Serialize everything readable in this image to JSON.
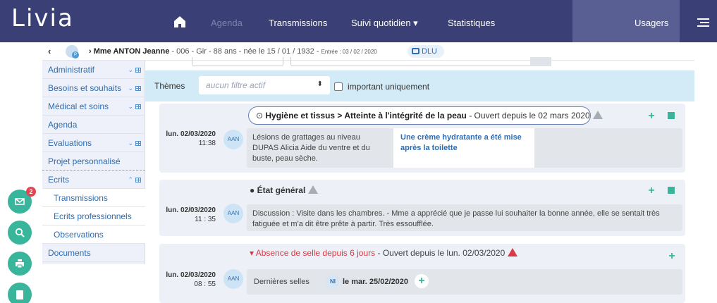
{
  "app": {
    "logo": "Livia"
  },
  "nav": {
    "items": [
      "Agenda",
      "Transmissions",
      "Suivi quotidien ▾",
      "Statistiques"
    ],
    "usagers": "Usagers"
  },
  "patient": {
    "name": "Mme ANTON Jeanne",
    "meta": " - 006 - Gir - 88 ans - née le 15 / 01 / 1932 - ",
    "entry": "Entrée : 03 / 02 / 2020",
    "dlu": "DLU",
    "avatar_badge": "P"
  },
  "sidebar": {
    "items": [
      {
        "label": "Administratif"
      },
      {
        "label": "Besoins et souhaits"
      },
      {
        "label": "Médical et soins"
      },
      {
        "label": "Agenda"
      },
      {
        "label": "Evaluations"
      },
      {
        "label": "Projet personnalisé"
      },
      {
        "label": "Ecrits"
      },
      {
        "label": "Transmissions"
      },
      {
        "label": "Ecrits professionnels"
      },
      {
        "label": "Observations"
      },
      {
        "label": "Documents"
      }
    ]
  },
  "fabs": {
    "mail_badge": "2"
  },
  "filters": {
    "themes_label": "Thèmes",
    "select_value": "aucun filtre actif",
    "important_label": "important uniquement"
  },
  "cards": [
    {
      "title_bold": "Hygiène et tissus > Atteinte à l'intégrité de la peau",
      "title_rest": " - Ouvert depuis le 02 mars 2020",
      "date": "lun. 02/03/2020",
      "time": "11:38",
      "author": "AAN",
      "text": "Lésions de grattages au niveau DUPAS Alicia Aide du ventre et du buste, peau sèche.",
      "note": "Une crème hydratante a été mise après la toilette"
    },
    {
      "title_bold": "État général",
      "date": "lun. 02/03/2020",
      "time": "11 : 35",
      "author": "AAN",
      "text": "Discussion : Visite dans les chambres. - Mme a apprécié que je passe lui souhaiter la bonne année, elle se sentait très fatiguée et m'a dit être prête à partir. Très essoufflée."
    },
    {
      "title_bold": "Absence de selle depuis 6 jours",
      "title_rest": " - Ouvert depuis le lun. 02/03/2020",
      "date": "lun. 02/03/2020",
      "time": "08 : 55",
      "author": "AAN",
      "text": "Dernières selles",
      "ni": "NI",
      "last_date": "le mar. 25/02/2020"
    }
  ],
  "colors": {
    "navbar": "#3a3f75",
    "accent": "#38b59b",
    "alert": "#d93a46",
    "link": "#2c6db3"
  }
}
